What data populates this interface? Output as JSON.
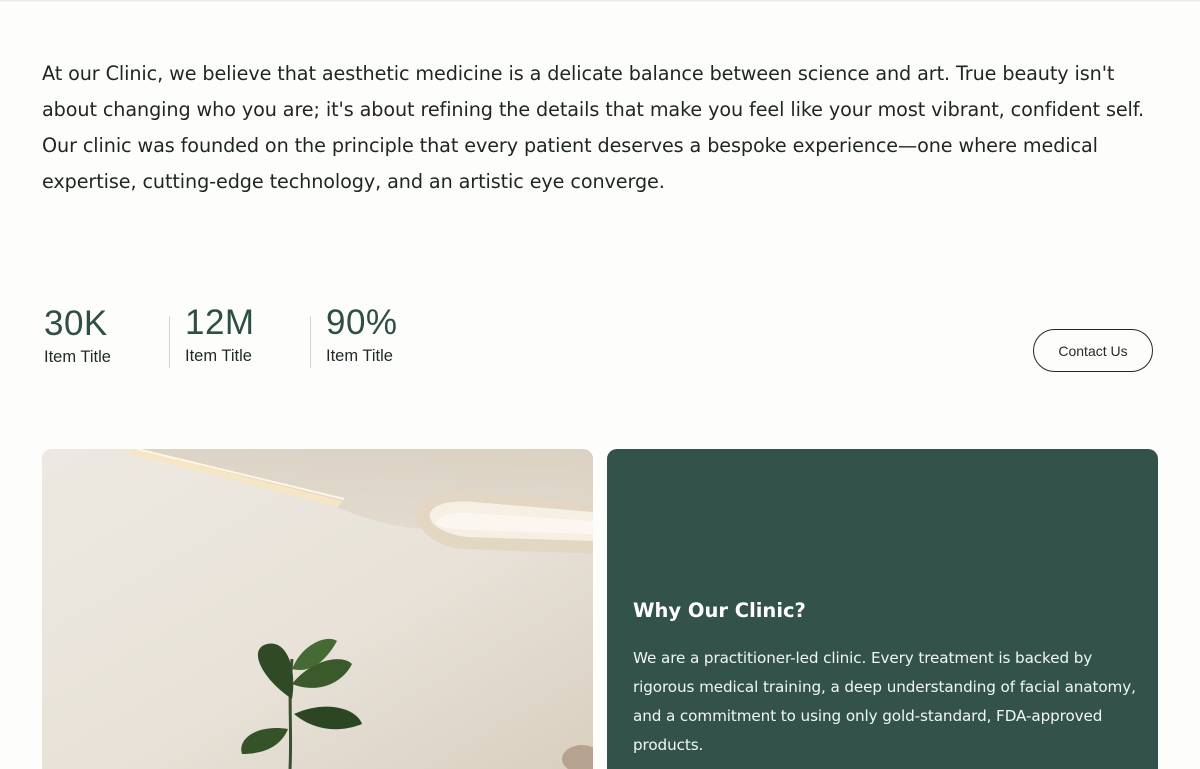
{
  "intro": {
    "text": "At our Clinic, we believe that aesthetic medicine is a delicate balance between science and art. True beauty isn't about changing who you are; it's about refining the details that make you feel like your most vibrant, confident self. Our clinic was founded on the principle that every patient deserves a bespoke experience—one where medical expertise, cutting-edge technology, and an artistic eye converge."
  },
  "stats": [
    {
      "value": "30K",
      "label": "Item Title"
    },
    {
      "value": "12M",
      "label": "Item Title"
    },
    {
      "value": "90%",
      "label": "Item Title"
    }
  ],
  "contact_button": {
    "label": "Contact Us"
  },
  "info_card": {
    "title": "Why Our Clinic?",
    "body": "We are a practitioner-led clinic. Every treatment is backed by rigorous medical training, a deep understanding of facial anatomy, and a commitment to using only gold-standard, FDA-approved products."
  },
  "colors": {
    "accent_green": "#32524a",
    "stat_value": "#2f4f45",
    "image_background": "#e7e1d7"
  }
}
